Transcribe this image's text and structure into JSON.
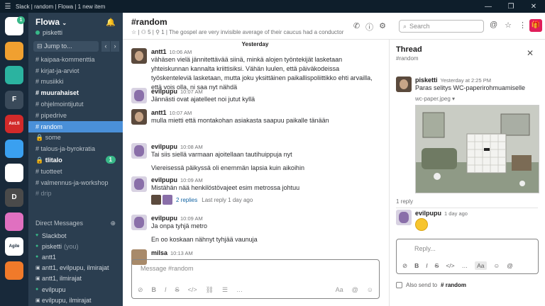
{
  "window": {
    "title": "Slack | random | Flowa | 1 new item"
  },
  "workspaces": [
    {
      "icon": "flowa-workspace-icon",
      "color": "#ffffff",
      "badge": "1"
    },
    {
      "icon": "grid-workspace-icon",
      "color": "#f0a030"
    },
    {
      "icon": "ring-workspace-icon",
      "color": "#2bb3a0"
    },
    {
      "icon": "letter-f-workspace",
      "letter": "F",
      "color": "#3a4a5a"
    },
    {
      "icon": "anttila-workspace-icon",
      "letter": "Ant.fi",
      "color": "#d22a2a"
    },
    {
      "icon": "blue-sphere-workspace-icon",
      "color": "#3aa0f0"
    },
    {
      "icon": "stack-workspace-icon",
      "color": "#ffffff"
    },
    {
      "icon": "letter-d-workspace",
      "letter": "D",
      "color": "#4a4a4a"
    },
    {
      "icon": "gradient-workspace-icon",
      "color": "#e070c0"
    },
    {
      "icon": "agile-workspace-icon",
      "letter": "Agile",
      "color": "#ffffff"
    },
    {
      "icon": "orange-circle-workspace-icon",
      "color": "#f07a2a"
    }
  ],
  "sidebar": {
    "workspace_name": "Flowa",
    "username": "pisketti",
    "jump_to": "Jump to...",
    "channels": [
      {
        "label": "# kaipaa-kommenttia"
      },
      {
        "label": "# kirjat-ja-arviot"
      },
      {
        "label": "# musiikki"
      },
      {
        "label": "# muurahaiset",
        "bold": true
      },
      {
        "label": "# ohjelmointijutut"
      },
      {
        "label": "# pipedrive"
      },
      {
        "label": "# random",
        "active": true
      },
      {
        "label": "🔒 some"
      },
      {
        "label": "# talous-ja-byrokratia"
      },
      {
        "label": "🔒 tlitalo",
        "bold": true,
        "badge": "1"
      },
      {
        "label": "# tuotteet"
      },
      {
        "label": "# valmennus-ja-workshop"
      },
      {
        "label": "# drip",
        "faded": true
      }
    ],
    "dm_header": "Direct Messages",
    "dms": [
      {
        "prefix": "♥",
        "label": "Slackbot"
      },
      {
        "prefix": "●",
        "label": "pisketti",
        "suffix": "(you)"
      },
      {
        "prefix": "●",
        "label": "antt1"
      },
      {
        "prefix": "▣",
        "label": "antt1, evilpupu, ilmirajat"
      },
      {
        "prefix": "▣",
        "label": "antt1, ilmirajat"
      },
      {
        "prefix": "●",
        "label": "evilpupu"
      },
      {
        "prefix": "▣",
        "label": "evilpupu, ilmirajat"
      },
      {
        "prefix": "●",
        "label": "ilmirajat"
      }
    ]
  },
  "channel": {
    "name": "#random",
    "members": "5",
    "pinned": "1",
    "topic": "The gospel are very invisible average of their caucus had a conductor"
  },
  "search": {
    "placeholder": "Search"
  },
  "messages": [
    {
      "author": "",
      "time": "",
      "text": "Yesterday",
      "kind": "divider"
    },
    {
      "author": "antt1",
      "time": "10:06 AM",
      "text": "vähäsen vielä jännitettävää siinä, minkä alojen työntekijät lasketaan yhteiskunnan kannalta kriittisiksi. Vähän luulen, että päiväkodeissa työskenteleviä lasketaan, mutta joku yksittäinen paikallispoliittikko ehti arvailla, että vois olla, ni saa nyt nähdä",
      "avatar": "antt"
    },
    {
      "author": "evilpupu",
      "time": "10:07 AM",
      "text": "Jännästi ovat ajatelleet noi jutut kyllä",
      "avatar": "evil"
    },
    {
      "author": "antt1",
      "time": "10:07 AM",
      "text": "mulla mietti että montakohan asiakasta saapuu paikalle tänään",
      "avatar": "antt"
    },
    {
      "author": "evilpupu",
      "time": "10:08 AM",
      "text": "Tai siis siellä varmaan ajoitellaan tautihuippuja nyt",
      "text2": "Viereisessä päikyssä oli enemmän lapsia kuin aikoihin",
      "avatar": "evil"
    },
    {
      "author": "evilpupu",
      "time": "10:09 AM",
      "text": "Mistähän nää henkilöstövajeet esim metrossa johtuu",
      "avatar": "evil",
      "replies": "2 replies",
      "last_reply": "Last reply 1 day ago"
    },
    {
      "author": "evilpupu",
      "time": "10:09 AM",
      "text": "Ja onpa tyhjä metro",
      "text2": "En oo koskaan nähnyt tyhjää vaunuja",
      "avatar": "evil"
    },
    {
      "author": "milsa",
      "time": "10:13 AM",
      "text": "",
      "avatar": "milsa"
    }
  ],
  "composer": {
    "placeholder": "Message #random"
  },
  "thread": {
    "title": "Thread",
    "subtitle": "#random",
    "parent": {
      "author": "pisketti",
      "time": "Yesterday at 2:25 PM",
      "text": "Paras selitys WC-paperirohmuamiselle",
      "file": "wc-paper.jpeg"
    },
    "reply_count": "1 reply",
    "reply": {
      "author": "evilpupu",
      "time": "1 day ago"
    },
    "reply_placeholder": "Reply...",
    "also_send": "Also send to",
    "also_channel": "# random"
  }
}
